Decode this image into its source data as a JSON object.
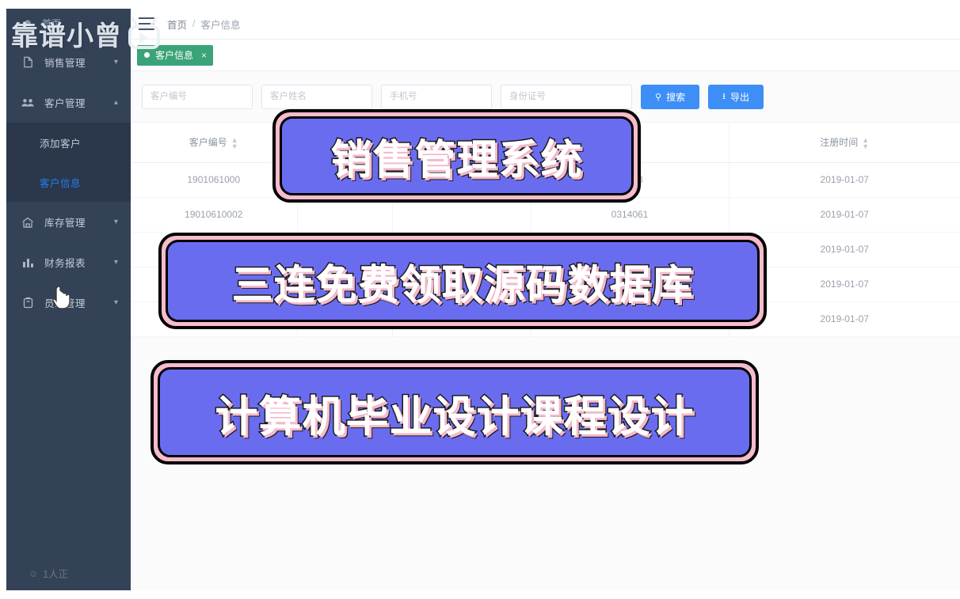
{
  "sidebar": {
    "home_label": "首页",
    "home_icon": "home-icon",
    "items": [
      {
        "label": "销售管理",
        "icon": "sales-icon",
        "arrow": "chevron-down-icon",
        "expanded": false
      },
      {
        "label": "客户管理",
        "icon": "customer-icon",
        "arrow": "chevron-up-icon",
        "expanded": true
      },
      {
        "label": "库存管理",
        "icon": "warehouse-icon",
        "arrow": "chevron-down-icon",
        "expanded": false
      },
      {
        "label": "财务报表",
        "icon": "chart-icon",
        "arrow": "chevron-down-icon",
        "expanded": false
      },
      {
        "label": "员工管理",
        "icon": "employee-icon",
        "arrow": "chevron-down-icon",
        "expanded": false
      }
    ],
    "submenu": [
      {
        "label": "添加客户",
        "active": false
      },
      {
        "label": "客户信息",
        "active": true
      }
    ],
    "viewers_label": "1人正",
    "viewers_icon": "viewers-icon",
    "active_color": "#2080f0",
    "bg_color": "#344258",
    "submenu_bg_color": "#2b374a"
  },
  "topbar": {
    "menu_toggle_icon": "hamburger-icon",
    "breadcrumb": {
      "home": "首页",
      "separator": "/",
      "current": "客户信息"
    }
  },
  "tabbar": {
    "tabs": [
      {
        "label": "客户信息",
        "close": "×",
        "active": true,
        "color": "#3aa377"
      }
    ]
  },
  "search": {
    "fields": [
      {
        "name": "customer-no",
        "placeholder": "客户编号",
        "value": ""
      },
      {
        "name": "customer-name",
        "placeholder": "客户姓名",
        "value": ""
      },
      {
        "name": "phone",
        "placeholder": "手机号",
        "value": ""
      },
      {
        "name": "id-card",
        "placeholder": "身份证号",
        "value": ""
      }
    ],
    "search_button": {
      "label": "搜索",
      "icon": "search-icon"
    },
    "export_button": {
      "label": "导出",
      "icon": "download-icon"
    },
    "button_color": "#3d8ef7"
  },
  "table": {
    "columns": [
      {
        "label": "客户编号",
        "sortable": true
      },
      {
        "label": "",
        "sortable": false
      },
      {
        "label": "",
        "sortable": false
      },
      {
        "label": "",
        "sortable": false
      },
      {
        "label": "注册时间",
        "sortable": true
      }
    ],
    "rows": [
      {
        "customer_no": "1901061000",
        "name": "",
        "phone": "",
        "id_card": "67833",
        "reg_time": "2019-01-07"
      },
      {
        "customer_no": "19010610002",
        "name": "",
        "phone": "",
        "id_card": "0314061",
        "reg_time": "2019-01-07"
      },
      {
        "customer_no": "",
        "name": "",
        "phone": "",
        "id_card": "",
        "reg_time": "2019-01-07"
      },
      {
        "customer_no": "",
        "name": "",
        "phone": "",
        "id_card": "",
        "reg_time": "2019-01-07"
      },
      {
        "customer_no": "",
        "name": "",
        "phone": "",
        "id_card": "",
        "reg_time": "2019-01-07"
      }
    ]
  },
  "overlays": {
    "banner1": "销售管理系统",
    "banner2": "三连免费领取源码数据库",
    "banner3": "计算机毕业设计课程设计",
    "banner_fill": "#6a6cf0",
    "banner_border": "#f6bccb"
  },
  "watermark": {
    "text": "靠谱小曾",
    "logo_icon": "bilibili-logo-icon"
  }
}
